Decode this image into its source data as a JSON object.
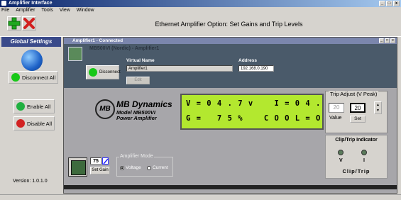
{
  "window": {
    "title": "Amplifier Interface"
  },
  "menu": [
    "File",
    "Amplifier",
    "Tools",
    "View",
    "Window"
  ],
  "toolbar": {
    "add_icon": "plus-icon",
    "remove_icon": "x-icon",
    "title": "Ethernet Amplifier Option: Set Gains and Trip Levels"
  },
  "global": {
    "title": "Global Settings",
    "disconnect_all": "Disconnect All",
    "enable_all": "Enable All",
    "disable_all": "Disable All",
    "version": "Version: 1.0.1.0"
  },
  "amp": {
    "window_title": "Amplifier1 - Connected",
    "device_heading": "MB500VI (Nordic) - Amplifier1",
    "disconnect": "Disconnect",
    "virtual_name_label": "Virtual Name",
    "virtual_name": "Amplifier1",
    "address_label": "Address",
    "address": "192.168.0.190",
    "edit": "Edit",
    "brand": {
      "logo": "MB",
      "name": "MB Dynamics",
      "model": "Model MB500VI",
      "desc": "Power Amplifier"
    },
    "lcd": {
      "line1": "V = 0 4 . 7 v    I = 0 4 . 3 a",
      "line2": "G =   7 5 %    C O O L = O F F"
    },
    "trip": {
      "title": "Trip Adjust (V Peak)",
      "current_value": "20",
      "set_value": "20",
      "value_label": "Value",
      "set": "Set"
    },
    "clip": {
      "title": "Clip/Trip Indicator",
      "v_label": "V",
      "i_label": "I",
      "label": "Clip/Trip"
    },
    "gain": {
      "value": "75",
      "set_gain": "Set Gain"
    },
    "mode": {
      "title": "Amplifier Mode",
      "voltage": "Voltage",
      "current": "Current",
      "selected": "Voltage"
    }
  },
  "colors": {
    "lcd_bg": "#b3e82f",
    "status_green": "#18c818",
    "title_blue": "#0a246a"
  }
}
